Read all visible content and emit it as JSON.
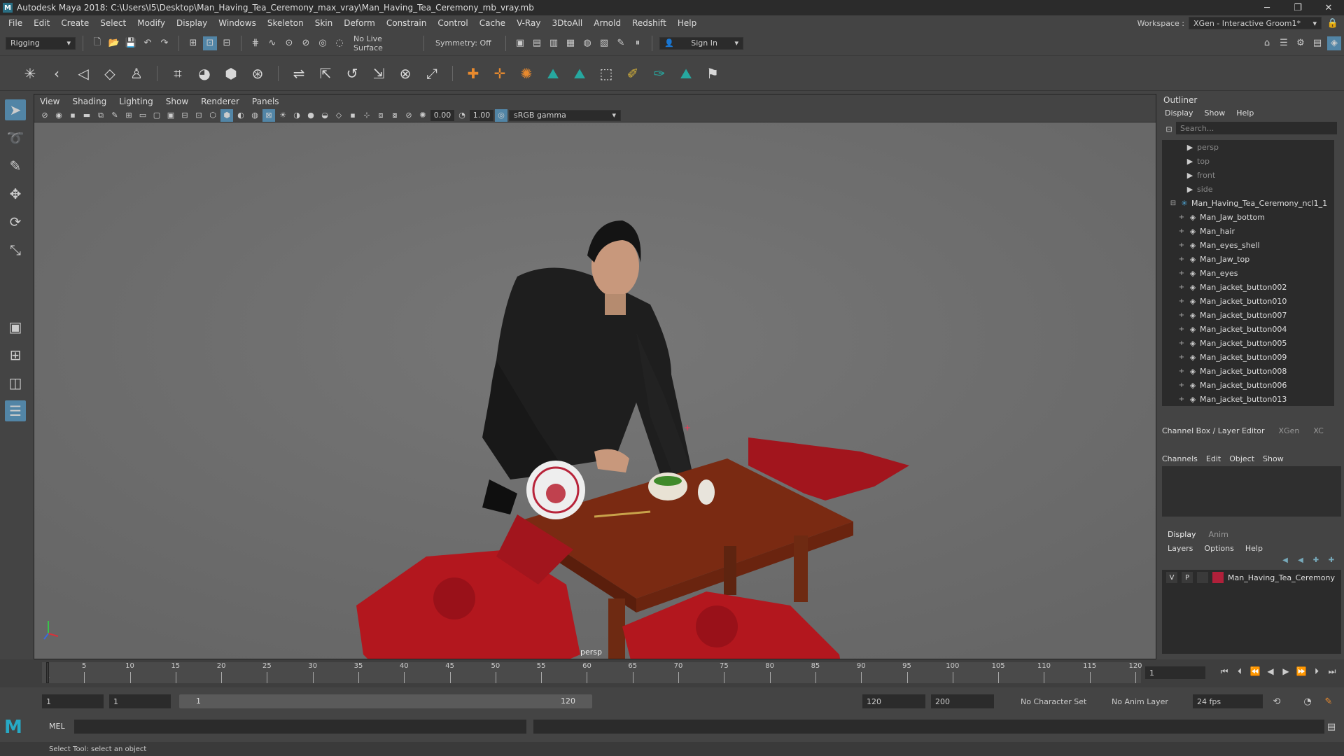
{
  "app": {
    "title": "Autodesk Maya 2018: C:\\Users\\I5\\Desktop\\Man_Having_Tea_Ceremony_max_vray\\Man_Having_Tea_Ceremony_mb_vray.mb",
    "logo_letter": "M"
  },
  "menu": [
    "File",
    "Edit",
    "Create",
    "Select",
    "Modify",
    "Display",
    "Windows",
    "Skeleton",
    "Skin",
    "Deform",
    "Constrain",
    "Control",
    "Cache",
    "V-Ray",
    "3DtoAll",
    "Arnold",
    "Redshift",
    "Help"
  ],
  "workspace": {
    "label": "Workspace :",
    "value": "XGen - Interactive Groom1*"
  },
  "statusline": {
    "mode": "Rigging",
    "live_surface": "No Live Surface",
    "symmetry": "Symmetry: Off",
    "sign_in": "Sign In"
  },
  "viewport": {
    "menu": [
      "View",
      "Shading",
      "Lighting",
      "Show",
      "Renderer",
      "Panels"
    ],
    "exposure": "0.00",
    "gamma": "1.00",
    "color_space": "sRGB gamma",
    "camera_label": "persp"
  },
  "outliner": {
    "title": "Outliner",
    "menu": [
      "Display",
      "Show",
      "Help"
    ],
    "search_placeholder": "Search...",
    "cameras": [
      "persp",
      "top",
      "front",
      "side"
    ],
    "group": "Man_Having_Tea_Ceremony_ncl1_1",
    "items": [
      "Man_Jaw_bottom",
      "Man_hair",
      "Man_eyes_shell",
      "Man_Jaw_top",
      "Man_eyes",
      "Man_jacket_button002",
      "Man_jacket_button010",
      "Man_jacket_button007",
      "Man_jacket_button004",
      "Man_jacket_button005",
      "Man_jacket_button009",
      "Man_jacket_button008",
      "Man_jacket_button006",
      "Man_jacket_button013"
    ]
  },
  "channel_box": {
    "tabs": [
      "Channel Box / Layer Editor",
      "XGen",
      "XC"
    ],
    "menu": [
      "Channels",
      "Edit",
      "Object",
      "Show"
    ]
  },
  "layers": {
    "tabs": [
      "Display",
      "Anim"
    ],
    "menu": [
      "Layers",
      "Options",
      "Help"
    ],
    "rows": [
      {
        "v": "V",
        "p": "P",
        "name": "Man_Having_Tea_Ceremony",
        "color": "#b0203a"
      }
    ]
  },
  "timeline": {
    "ticks": [
      "5",
      "10",
      "15",
      "20",
      "25",
      "30",
      "35",
      "40",
      "45",
      "50",
      "55",
      "60",
      "65",
      "70",
      "75",
      "80",
      "85",
      "90",
      "95",
      "100",
      "105",
      "110",
      "115",
      "120"
    ],
    "start_label": "1",
    "current_frame": "1"
  },
  "range": {
    "start": "1",
    "playback_start": "1",
    "slider_start": "1",
    "slider_end": "120",
    "playback_end": "120",
    "end": "200",
    "character_set": "No Character Set",
    "anim_layer": "No Anim Layer",
    "fps": "24 fps"
  },
  "command": {
    "lang": "MEL"
  },
  "help_line": "Select Tool: select an object",
  "colors": {
    "accent": "#5285a6",
    "viewport_bg": "#6d6d6d"
  }
}
